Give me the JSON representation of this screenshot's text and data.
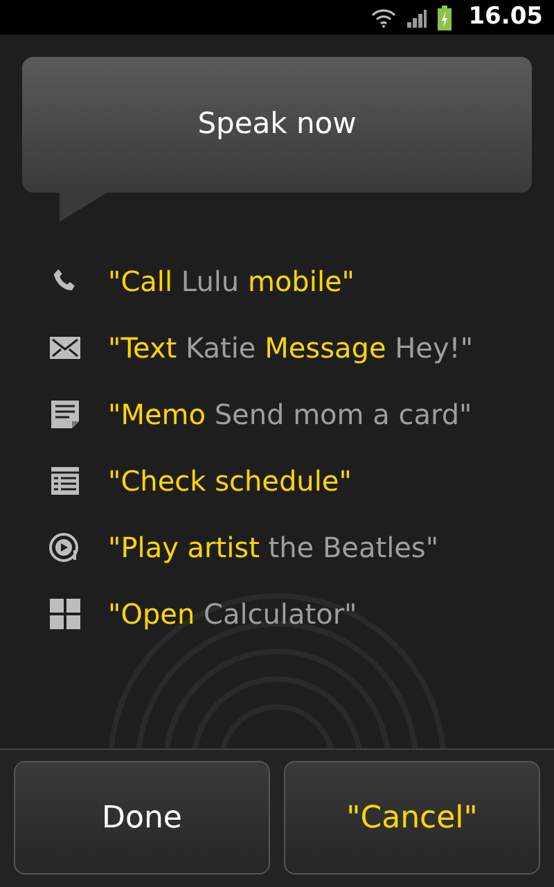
{
  "status_bar": {
    "time": "16.05"
  },
  "prompt": {
    "title": "Speak now"
  },
  "commands": [
    {
      "kind": "phone",
      "segments": [
        {
          "kind": "keyword",
          "text": "\"Call"
        },
        {
          "kind": "value",
          "text": "Lulu"
        },
        {
          "kind": "keyword",
          "text": "mobile\""
        }
      ]
    },
    {
      "kind": "mail",
      "segments": [
        {
          "kind": "keyword",
          "text": "\"Text"
        },
        {
          "kind": "value",
          "text": "Katie"
        },
        {
          "kind": "keyword",
          "text": "Message"
        },
        {
          "kind": "value",
          "text": "Hey!\""
        }
      ]
    },
    {
      "kind": "memo",
      "segments": [
        {
          "kind": "keyword",
          "text": "\"Memo"
        },
        {
          "kind": "value",
          "text": "Send mom a card\""
        }
      ]
    },
    {
      "kind": "schedule",
      "segments": [
        {
          "kind": "keyword",
          "text": "\"Check schedule\""
        }
      ]
    },
    {
      "kind": "music",
      "segments": [
        {
          "kind": "keyword",
          "text": "\"Play artist"
        },
        {
          "kind": "value",
          "text": "the Beatles\""
        }
      ]
    },
    {
      "kind": "apps",
      "segments": [
        {
          "kind": "keyword",
          "text": "\"Open"
        },
        {
          "kind": "value",
          "text": "Calculator\""
        }
      ]
    }
  ],
  "buttons": [
    {
      "label": "Done",
      "kind": "plain"
    },
    {
      "label": "\"Cancel\"",
      "kind": "keyword"
    }
  ]
}
